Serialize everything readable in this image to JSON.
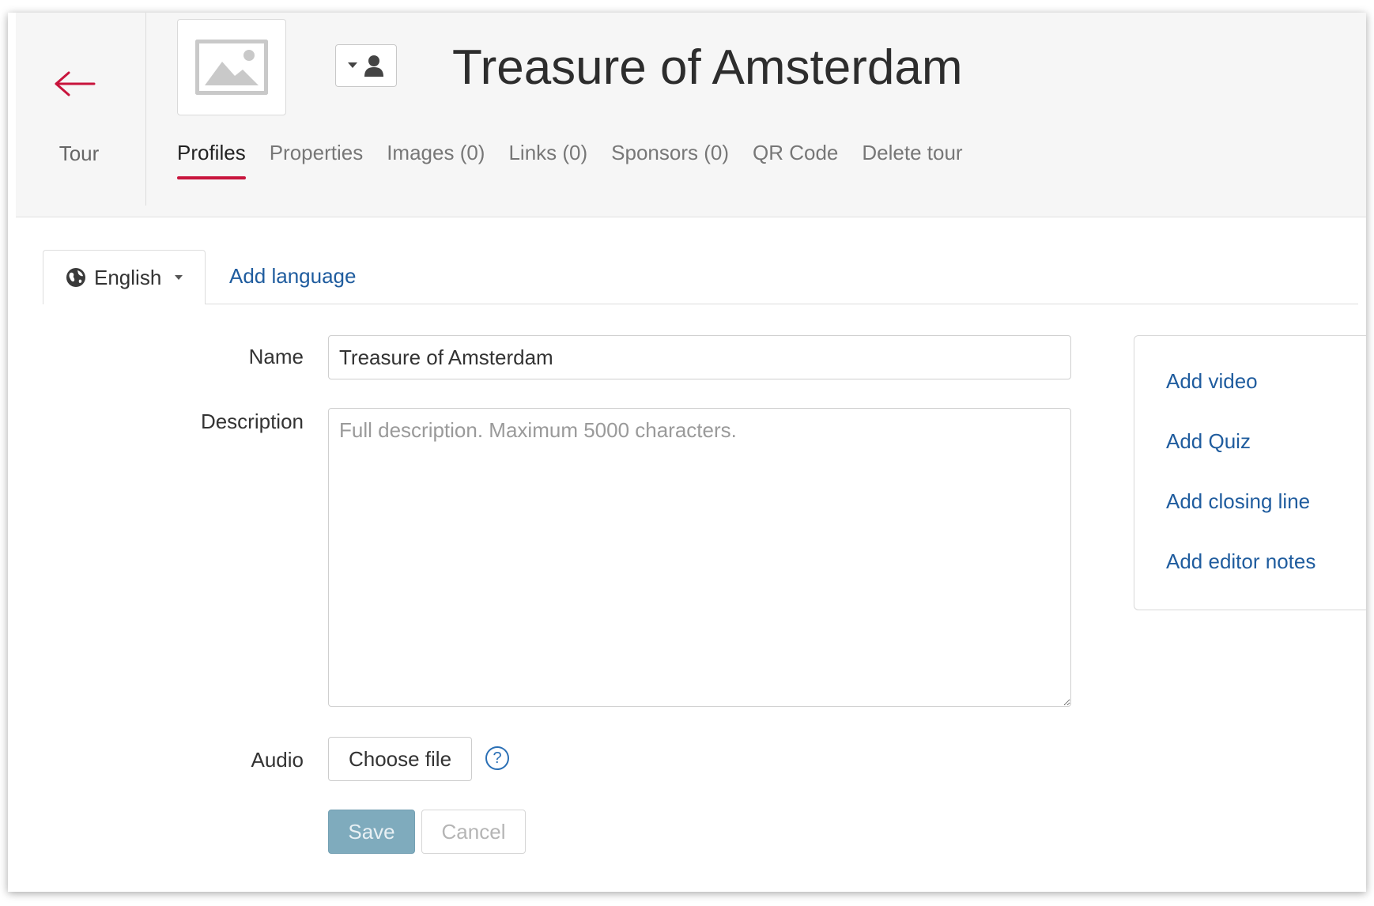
{
  "header": {
    "back_label": "Tour",
    "title": "Treasure of Amsterdam",
    "tabs": [
      {
        "label": "Profiles",
        "active": true
      },
      {
        "label": "Properties"
      },
      {
        "label": "Images (0)"
      },
      {
        "label": "Links (0)"
      },
      {
        "label": "Sponsors (0)"
      },
      {
        "label": "QR Code"
      },
      {
        "label": "Delete tour"
      }
    ],
    "icons": {
      "back": "arrow-left-icon",
      "thumbnail": "image-placeholder-icon",
      "user_dropdown": "user-icon"
    },
    "accent_color": "#c8143c"
  },
  "language": {
    "current": "English",
    "add_label": "Add language",
    "icon": "globe-icon"
  },
  "form": {
    "name_label": "Name",
    "name_value": "Treasure of Amsterdam",
    "description_label": "Description",
    "description_placeholder": "Full description. Maximum 5000 characters.",
    "audio_label": "Audio",
    "choose_file_label": "Choose file",
    "help_glyph": "?",
    "save_label": "Save",
    "cancel_label": "Cancel"
  },
  "side_panel": {
    "links": [
      "Add video",
      "Add Quiz",
      "Add closing line",
      "Add editor notes"
    ]
  },
  "colors": {
    "link": "#1f5c9e",
    "save_button": "#7fabbd"
  }
}
